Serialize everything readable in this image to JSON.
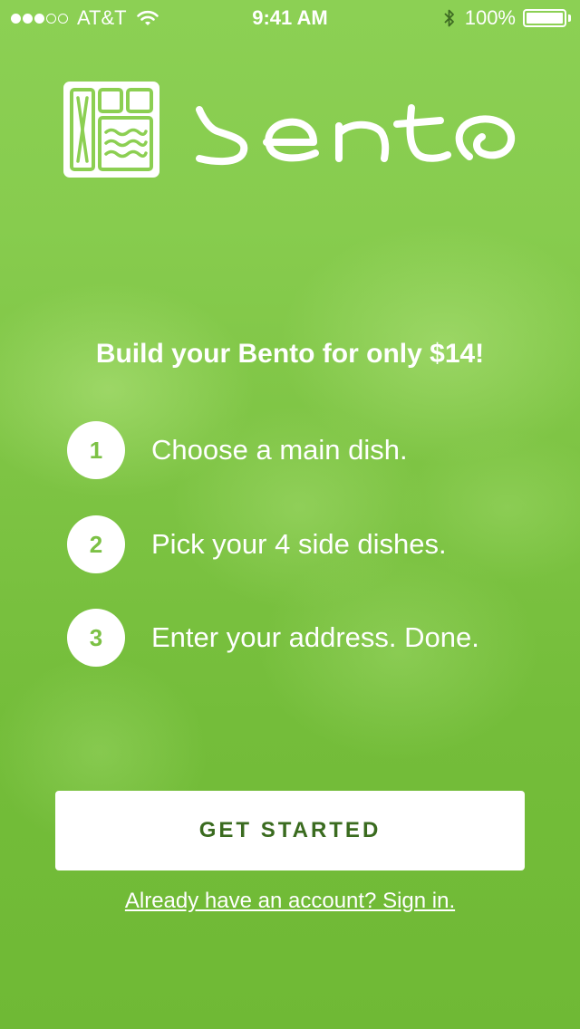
{
  "status_bar": {
    "carrier": "AT&T",
    "time": "9:41 AM",
    "battery": "100%",
    "signal_bars_filled": 3,
    "signal_bars_total": 5,
    "battery_level": 1.0,
    "icons": [
      "signal-icon",
      "wifi-icon",
      "bluetooth-icon",
      "battery-icon"
    ]
  },
  "brand": {
    "logo_icon": "bento-box-icon"
  },
  "tagline": "Build your Bento for only $14!",
  "steps": [
    {
      "number": "1",
      "text": "Choose a main dish."
    },
    {
      "number": "2",
      "text": "Pick your 4 side dishes."
    },
    {
      "number": "3",
      "text": "Enter your address. Done."
    }
  ],
  "actions": {
    "get_started": "GET STARTED",
    "sign_in": "Already have an account? Sign in."
  },
  "colors": {
    "background": "#7cc63f",
    "button_text": "#3a6b1f",
    "step_number": "#7cc145",
    "white": "#ffffff"
  }
}
